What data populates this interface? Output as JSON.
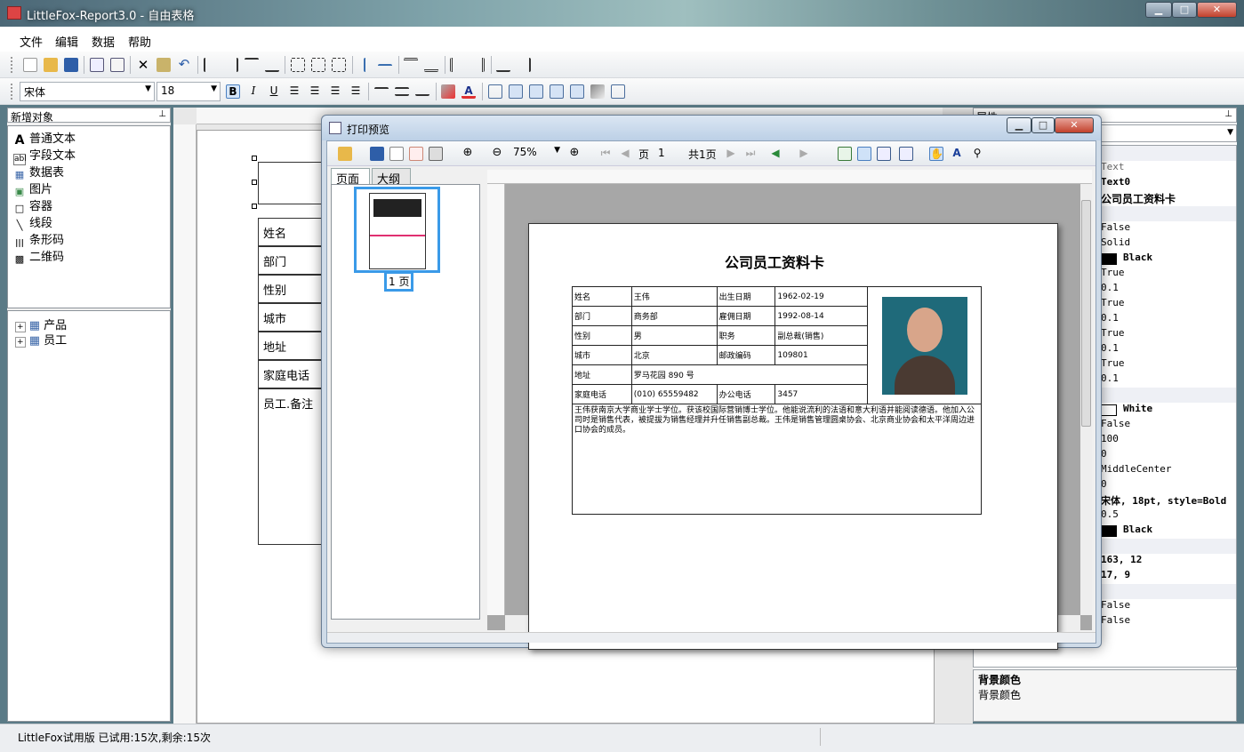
{
  "window": {
    "title": "LittleFox-Report3.0 - 自由表格"
  },
  "menu": [
    "文件",
    "编辑",
    "数据",
    "帮助"
  ],
  "format": {
    "font": "宋体",
    "size": "18"
  },
  "left_panel": {
    "header": "新增对象",
    "objects": [
      {
        "icon": "A",
        "label": "普通文本"
      },
      {
        "icon": "abl",
        "label": "字段文本"
      },
      {
        "icon": "▦",
        "label": "数据表"
      },
      {
        "icon": "▣",
        "label": "图片"
      },
      {
        "icon": "□",
        "label": "容器"
      },
      {
        "icon": "╲",
        "label": "线段"
      },
      {
        "icon": "|||",
        "label": "条形码"
      },
      {
        "icon": "▩",
        "label": "二维码"
      }
    ],
    "tree": [
      "产品",
      "员工"
    ]
  },
  "designer": {
    "fields": [
      "姓名",
      "部门",
      "性别",
      "城市",
      "地址",
      "家庭电话",
      "员工.备注"
    ]
  },
  "properties": {
    "header": "属性",
    "rows": [
      "Text",
      "Text0",
      "公司员工资料卡",
      "False",
      "Solid",
      "Black",
      "True",
      "0.1",
      "True",
      "0.1",
      "True",
      "0.1",
      "True",
      "0.1",
      "White",
      "False",
      "100",
      "0",
      "MiddleCenter",
      "0",
      "宋体, 18pt, style=Bold",
      "0.5",
      "Black",
      "163, 12",
      "17, 9",
      "False",
      "False"
    ],
    "desc_title": "背景颜色",
    "desc_text": "背景颜色"
  },
  "status": {
    "text": "LittleFox试用版 已试用:15次,剩余:15次"
  },
  "preview": {
    "title": "打印预览",
    "zoom": "75%",
    "page_label": "页",
    "page_no": "1",
    "total": "共1页",
    "tabs": [
      "页面",
      "大纲"
    ],
    "thumb_label": "1 页",
    "card": {
      "title": "公司员工资料卡",
      "rows": [
        [
          "姓名",
          "王伟",
          "出生日期",
          "1962-02-19"
        ],
        [
          "部门",
          "商务部",
          "雇佣日期",
          "1992-08-14"
        ],
        [
          "性别",
          "男",
          "职务",
          "副总裁(销售)"
        ],
        [
          "城市",
          "北京",
          "邮政编码",
          "109801"
        ]
      ],
      "address_label": "地址",
      "address": "罗马花园 890 号",
      "phone_row": [
        "家庭电话",
        "(010) 65559482",
        "办公电话",
        "3457"
      ],
      "notes": "王伟获南京大学商业学士学位。获该校国际营销博士学位。他能说流利的法语和意大利语并能阅读德语。他加入公司时是销售代表，被提拔为销售经理并升任销售副总裁。王伟是销售管理圆桌协会、北京商业协会和太平洋周边进口协会的成员。"
    }
  }
}
